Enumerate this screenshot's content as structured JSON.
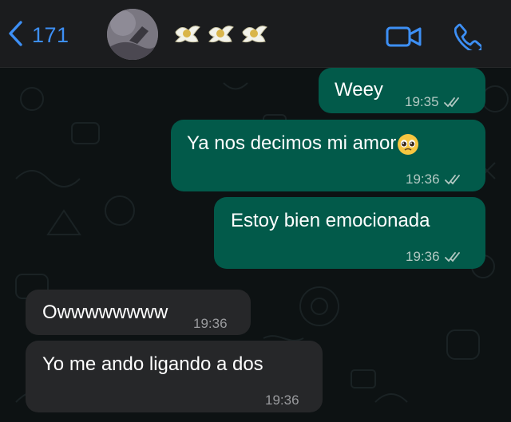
{
  "header": {
    "back_count": "171",
    "contact_name": "🕊️🕊️🕊️",
    "icons": [
      "chevron-left-icon",
      "avatar",
      "video-call-icon",
      "phone-icon"
    ],
    "accent_color": "#3d8ff5"
  },
  "messages": [
    {
      "direction": "outgoing",
      "text": "Weey",
      "time": "19:35",
      "status": "read-double-check"
    },
    {
      "direction": "outgoing",
      "text": "Ya nos decimos mi amor",
      "emoji": "pleading-face",
      "time": "19:36",
      "status": "read-double-check"
    },
    {
      "direction": "outgoing",
      "text": "Estoy bien emocionada",
      "time": "19:36",
      "status": "read-double-check"
    },
    {
      "direction": "incoming",
      "text": "Owwwwwwww",
      "time": "19:36"
    },
    {
      "direction": "incoming",
      "text": "Yo me ando ligando a dos",
      "time": "19:36"
    }
  ],
  "colors": {
    "outgoing_bubble": "#025a4a",
    "incoming_bubble": "#262729",
    "background": "#0b0f10",
    "header": "#1b1c1e"
  }
}
